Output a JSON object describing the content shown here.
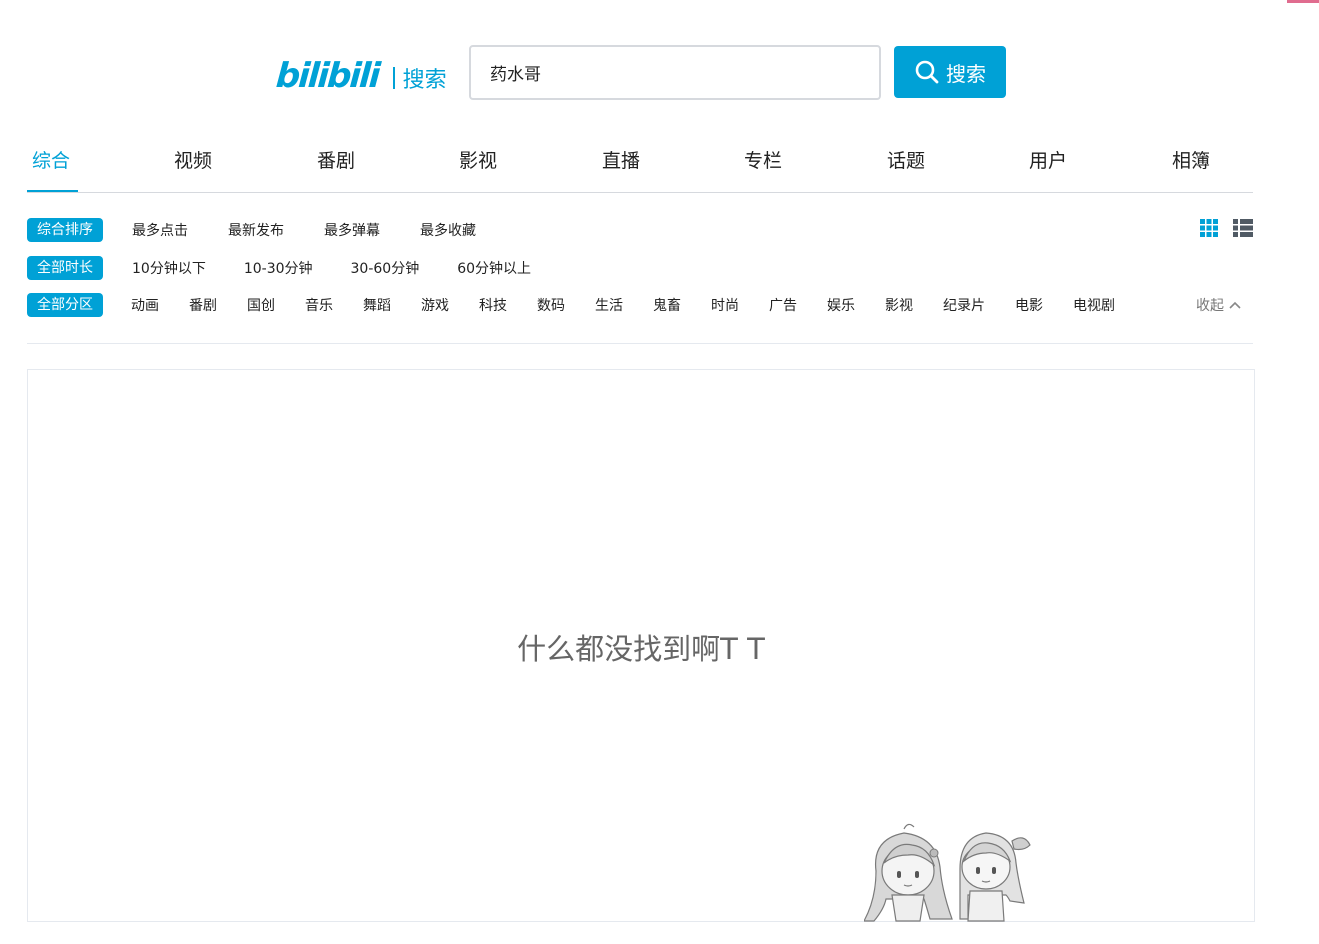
{
  "brand": {
    "logo_text": "bilibili",
    "section": "搜索",
    "color": "#00a1d6"
  },
  "search": {
    "value": "药水哥",
    "button_label": "搜索",
    "button_icon": "search-icon"
  },
  "tabs": [
    {
      "label": "综合",
      "active": true
    },
    {
      "label": "视频"
    },
    {
      "label": "番剧"
    },
    {
      "label": "影视"
    },
    {
      "label": "直播"
    },
    {
      "label": "专栏"
    },
    {
      "label": "话题"
    },
    {
      "label": "用户"
    },
    {
      "label": "相簿"
    }
  ],
  "filters": {
    "order": {
      "selected": "综合排序",
      "options": [
        "最多点击",
        "最新发布",
        "最多弹幕",
        "最多收藏"
      ]
    },
    "duration": {
      "selected": "全部时长",
      "options": [
        "10分钟以下",
        "10-30分钟",
        "30-60分钟",
        "60分钟以上"
      ]
    },
    "zone": {
      "selected": "全部分区",
      "options": [
        "动画",
        "番剧",
        "国创",
        "音乐",
        "舞蹈",
        "游戏",
        "科技",
        "数码",
        "生活",
        "鬼畜",
        "时尚",
        "广告",
        "娱乐",
        "影视",
        "纪录片",
        "电影",
        "电视剧"
      ],
      "collapse_label": "收起"
    }
  },
  "view_toggle": {
    "grid_icon": "grid-view-icon",
    "list_icon": "list-view-icon"
  },
  "results": {
    "empty_message": "什么都没找到啊T T"
  },
  "colors": {
    "accent": "#00a1d6",
    "border": "#d6d9de"
  }
}
